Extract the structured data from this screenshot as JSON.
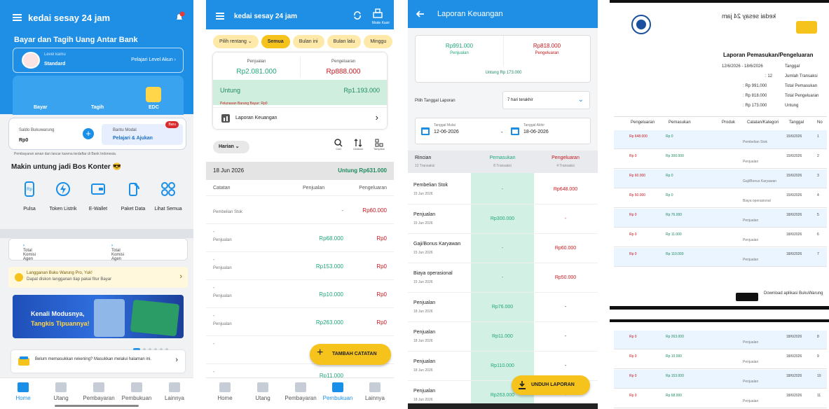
{
  "p1": {
    "app_title": "kedai sesay 24 jam",
    "bell_badge": "1",
    "headline": "Bayar dan Tagih Uang Antar Bank",
    "level_small": "Level kamu",
    "level_name": "Standard",
    "level_link": "Pelajari Level Akun",
    "pay_labels": [
      "Bayar",
      "Tagih",
      "EDC"
    ],
    "saldo_label": "Saldo Bukuwarung",
    "saldo_value": "Rp0",
    "modal_label": "Bantu Modal",
    "modal_value": "Pelajari & Ajukan",
    "new_badge": "Baru",
    "note": "Pembayaran aman dan lancar karena terdaftar di Bank Indonesia.",
    "section_title": "Makin untung jadi Bos Konter 😎",
    "services": [
      "Pulsa",
      "Token Listrik",
      "E-Wallet",
      "Paket Data",
      "Lihat Semua"
    ],
    "agen1": "Total Komisi Agen",
    "agen2": "Total Komisi Agen",
    "promo_title": "Langganan Buku Warung Pro, Yuk!",
    "promo_sub": "Dapat diskon langganan tiap pakai fitur Bayar",
    "banner_line1": "Kenali Modusnya,",
    "banner_line2": "Tangkis Tipuannya!",
    "rekening_text": "Belum memasukkan rekening? Masukkan melalui halaman ini.",
    "nav": [
      "Home",
      "Utang",
      "Pembayaran",
      "Pembukuan",
      "Lainnya"
    ]
  },
  "p2": {
    "app_title": "kedai sesay 24 jam",
    "mode_kasir": "Mode Kasir",
    "filters": [
      "Pilih rentang",
      "Semua",
      "Bulan ini",
      "Bulan lalu",
      "Minggu"
    ],
    "penjualan_label": "Penjualan",
    "penjualan_value": "Rp2.081.000",
    "pengeluaran_label": "Pengeluaran",
    "pengeluaran_value": "Rp888.000",
    "untung_label": "Untung",
    "untung_value": "Rp1.193.000",
    "untung_note": "Pelunasan Barang Bayar: Rp0",
    "laporan": "Laporan Keuangan",
    "harian": "Harian",
    "tools": [
      "Cari",
      "Urutkan",
      "Tampilan"
    ],
    "day": "18 Jun 2026",
    "day_total": "Untung Rp631.000",
    "col_catatan": "Catatan",
    "col_penjualan": "Penjualan",
    "col_pengeluaran": "Pengeluaran",
    "rows": [
      {
        "cat": "Pembelian Stok",
        "p": "-",
        "q": "Rp60.000",
        "dash": ""
      },
      {
        "cat": "Penjualan",
        "p": "Rp68.000",
        "q": "Rp0",
        "dash": "-"
      },
      {
        "cat": "Penjualan",
        "p": "Rp153.000",
        "q": "Rp0",
        "dash": "-"
      },
      {
        "cat": "Penjualan",
        "p": "Rp10.000",
        "q": "Rp0",
        "dash": "-"
      },
      {
        "cat": "Penjualan",
        "p": "Rp263.000",
        "q": "Rp0",
        "dash": "-"
      },
      {
        "cat": "",
        "p": "Rp110",
        "q": "",
        "dash": "-"
      },
      {
        "cat": "",
        "p": "Rp11.000",
        "q": "",
        "dash": "-"
      }
    ],
    "fab": "TAMBAH CATATAN",
    "nav": [
      "Home",
      "Utang",
      "Pembayaran",
      "Pembukuan",
      "Lainnya"
    ]
  },
  "p3": {
    "title": "Laporan Keuangan",
    "penjualan_value": "Rp991.000",
    "penjualan_label": "Penjualan",
    "pengeluaran_value": "Rp818.000",
    "pengeluaran_label": "Pengeluaran",
    "untung": "Untung   Rp 173.000",
    "pick_label": "Pilih Tanggal Laporan",
    "select_value": "7 hari terakhir",
    "date_from_label": "Tanggal Mulai",
    "date_from": "12-06-2026",
    "date_to_label": "Tanggal Akhir",
    "date_to": "18-06-2026",
    "h_rincian": "Rincian",
    "h_rincian_sub": "12 Transaksi",
    "h_pemasukan": "Pemasukan",
    "h_pemasukan_sub": "8 Transaksi",
    "h_pengeluaran": "Pengeluaran",
    "h_pengeluaran_sub": "4 Transaksi",
    "rows": [
      {
        "n": "Pembelian Stok",
        "d": "15 Jun 2026",
        "p": "-",
        "q": "Rp648.000"
      },
      {
        "n": "Penjualan",
        "d": "15 Jun 2026",
        "p": "Rp300.000",
        "q": "-"
      },
      {
        "n": "Gaji/Bonus Karyawan",
        "d": "15 Jun 2026",
        "p": "-",
        "q": "Rp60.000"
      },
      {
        "n": "Biaya operasional",
        "d": "15 Jun 2026",
        "p": "-",
        "q": "Rp50.000"
      },
      {
        "n": "Penjualan",
        "d": "18 Jun 2026",
        "p": "Rp76.000",
        "q": "-"
      },
      {
        "n": "Penjualan",
        "d": "18 Jun 2026",
        "p": "Rp11.000",
        "q": "-"
      },
      {
        "n": "Penjualan",
        "d": "18 Jun 2026",
        "p": "Rp110.000",
        "q": "-"
      },
      {
        "n": "Penjualan",
        "d": "18 Jun 2026",
        "p": "Rp263.000",
        "q": "-"
      }
    ],
    "fab": "UNDUH LAPORAN"
  },
  "p4": {
    "shop": "kedai sesay 24 jam",
    "report_title": "Laporan Pemasukan/Pengeluaran",
    "meta": [
      "Tanggal",
      "Jumlah Transaksi",
      "Total Pemasukan",
      "Total Pengeluaran",
      "Untung"
    ],
    "meta_vals": [
      "12/6/2026 - 18/6/2026",
      ": 12",
      ": Rp 991.000",
      ": Rp 818.000",
      ": Rp 173.000"
    ],
    "cols": [
      "No",
      "Tanggal",
      "Catatan/Kategori",
      "Produk",
      "Pemasukan",
      "Pengeluaran"
    ],
    "rows": [
      {
        "no": "1",
        "tgl": "15/6/2026",
        "cat": "Pembelian Stok",
        "masuk": "Rp 0",
        "keluar": "Rp 648.000"
      },
      {
        "no": "2",
        "tgl": "15/6/2026",
        "cat": "Penjualan",
        "masuk": "Rp 300.000",
        "keluar": "Rp 0"
      },
      {
        "no": "3",
        "tgl": "15/6/2026",
        "cat": "Gaji/Bonus Karyawan",
        "masuk": "Rp 0",
        "keluar": "Rp 60.000"
      },
      {
        "no": "4",
        "tgl": "15/6/2026",
        "cat": "Biaya operasional",
        "masuk": "Rp 0",
        "keluar": "Rp 50.000"
      },
      {
        "no": "5",
        "tgl": "18/6/2026",
        "cat": "Penjualan",
        "masuk": "Rp 76.000",
        "keluar": "Rp 0"
      },
      {
        "no": "6",
        "tgl": "18/6/2026",
        "cat": "Penjualan",
        "masuk": "Rp 11.000",
        "keluar": "Rp 0"
      },
      {
        "no": "7",
        "tgl": "18/6/2026",
        "cat": "Penjualan",
        "masuk": "Rp 110.000",
        "keluar": "Rp 0"
      }
    ],
    "rows2": [
      {
        "no": "8",
        "tgl": "18/6/2026",
        "cat": "Penjualan",
        "masuk": "Rp 263.000",
        "keluar": "Rp 0"
      },
      {
        "no": "9",
        "tgl": "18/6/2026",
        "cat": "Penjualan",
        "masuk": "Rp 10.000",
        "keluar": "Rp 0"
      },
      {
        "no": "10",
        "tgl": "18/6/2026",
        "cat": "Penjualan",
        "masuk": "Rp 153.000",
        "keluar": "Rp 0"
      },
      {
        "no": "11",
        "tgl": "18/6/2026",
        "cat": "Penjualan",
        "masuk": "Rp 68.000",
        "keluar": "Rp 0"
      }
    ],
    "footer": "Download aplikasi BukuWarung"
  },
  "colors": {
    "primary": "#1f8fe6",
    "accent": "#f6c21c",
    "green": "#1fa77b",
    "red": "#c8181e"
  }
}
